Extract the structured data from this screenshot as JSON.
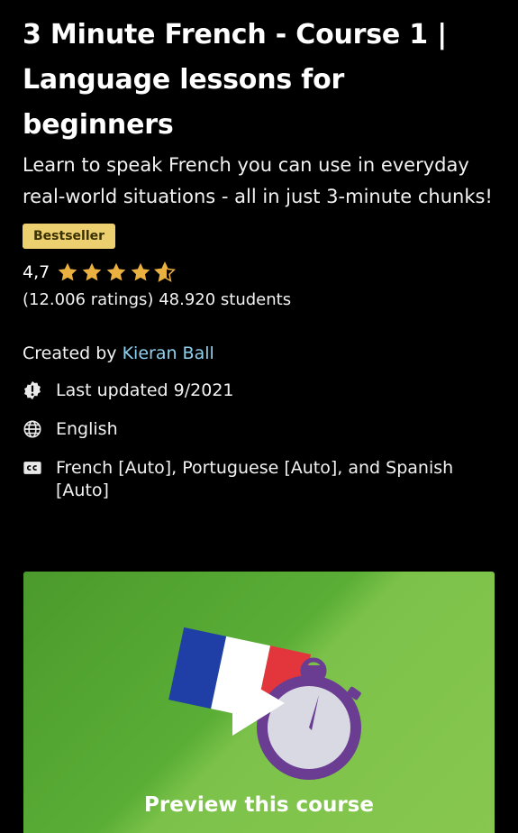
{
  "course": {
    "title": "3 Minute French - Course 1 | Language lessons for beginners",
    "subtitle": "Learn to speak French you can use in everyday real-world situations - all in just 3-minute chunks!",
    "badge": "Bestseller",
    "rating": "4,7",
    "rating_stars": 4.7,
    "ratings_count": "(12.006 ratings)",
    "students": "48.920 students",
    "created_by_label": "Created by",
    "creator": "Kieran Ball",
    "last_updated": "Last updated 9/2021",
    "language": "English",
    "captions": "French [Auto], Portuguese [Auto], and Spanish [Auto]"
  },
  "preview": {
    "label": "Preview this course"
  },
  "icons": {
    "updated": "alert-badge-icon",
    "language": "globe-icon",
    "captions": "closed-captions-icon"
  },
  "colors": {
    "background": "#000000",
    "badge": "#eccf6e",
    "star": "#eab140",
    "link": "#8fd0ef"
  }
}
